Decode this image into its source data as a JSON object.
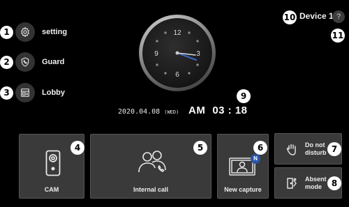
{
  "sidebar": {
    "items": [
      {
        "label": "setting",
        "icon": "gear-icon",
        "badge": "1"
      },
      {
        "label": "Guard",
        "icon": "shield-phone-icon",
        "badge": "2"
      },
      {
        "label": "Lobby",
        "icon": "lobby-panel-icon",
        "badge": "3"
      }
    ]
  },
  "device": {
    "name": "Device 1",
    "badge": "10",
    "help_label": "?",
    "help_badge": "11"
  },
  "clock": {
    "numerals": [
      "12",
      "3",
      "6",
      "9"
    ],
    "date": "2020.04.08",
    "weekday": "(WED)",
    "ampm": "AM",
    "time": "03 : 18",
    "badge": "9"
  },
  "tiles": {
    "cam": {
      "label": "CAM",
      "badge": "4",
      "icon": "doorbell-camera-icon"
    },
    "internal_call": {
      "label": "Internal call",
      "badge": "5",
      "icon": "people-call-icon"
    },
    "new_capture": {
      "label": "New capture",
      "badge": "6",
      "new_badge": "N",
      "icon": "capture-photo-icon"
    },
    "dnd": {
      "label_line1": "Do not",
      "label_line2": "disturb",
      "badge": "7",
      "icon": "hand-icon"
    },
    "absent": {
      "label_line1": "Absent",
      "label_line2": "mode",
      "badge": "8",
      "icon": "door-exit-icon"
    }
  },
  "colors": {
    "tile_bg": "#3a3a3a",
    "accent_badge": "#2b54a8",
    "clock_hand": "#3a66c4"
  }
}
